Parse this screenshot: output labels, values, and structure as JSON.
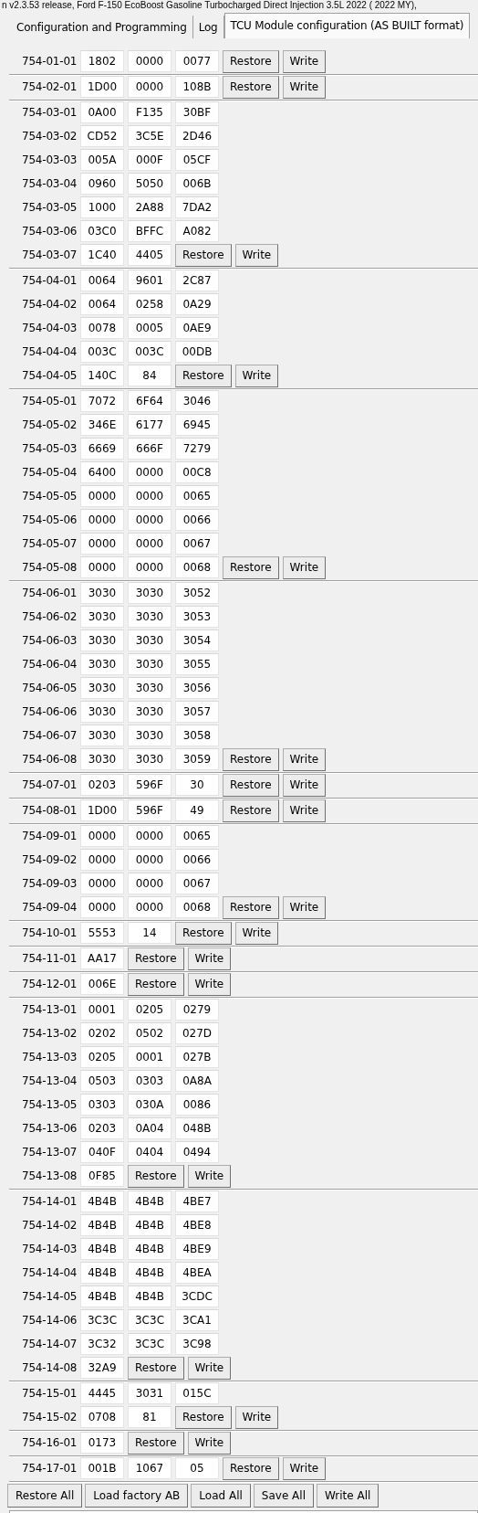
{
  "window": {
    "title": "n v2.3.53 release, Ford F-150 EcoBoost Gasoline Turbocharged Direct Injection 3.5L 2022 ( 2022 MY),"
  },
  "tabs": [
    {
      "label": "Configuration and Programming",
      "selected": false
    },
    {
      "label": "Log",
      "selected": false
    },
    {
      "label": "TCU Module configuration (AS BUILT format)",
      "selected": true
    }
  ],
  "groups": [
    {
      "rows": [
        {
          "id": "754-01-01",
          "values": [
            "1802",
            "0000",
            "0077"
          ],
          "actions": [
            "Restore",
            "Write"
          ]
        }
      ]
    },
    {
      "rows": [
        {
          "id": "754-02-01",
          "values": [
            "1D00",
            "0000",
            "108B"
          ],
          "actions": [
            "Restore",
            "Write"
          ]
        }
      ]
    },
    {
      "rows": [
        {
          "id": "754-03-01",
          "values": [
            "0A00",
            "F135",
            "30BF"
          ]
        },
        {
          "id": "754-03-02",
          "values": [
            "CD52",
            "3C5E",
            "2D46"
          ]
        },
        {
          "id": "754-03-03",
          "values": [
            "005A",
            "000F",
            "05CF"
          ]
        },
        {
          "id": "754-03-04",
          "values": [
            "0960",
            "5050",
            "006B"
          ]
        },
        {
          "id": "754-03-05",
          "values": [
            "1000",
            "2A88",
            "7DA2"
          ]
        },
        {
          "id": "754-03-06",
          "values": [
            "03C0",
            "BFFC",
            "A082"
          ]
        },
        {
          "id": "754-03-07",
          "values": [
            "1C40",
            "4405"
          ],
          "actions": [
            "Restore",
            "Write"
          ]
        }
      ]
    },
    {
      "rows": [
        {
          "id": "754-04-01",
          "values": [
            "0064",
            "9601",
            "2C87"
          ]
        },
        {
          "id": "754-04-02",
          "values": [
            "0064",
            "0258",
            "0A29"
          ]
        },
        {
          "id": "754-04-03",
          "values": [
            "0078",
            "0005",
            "0AE9"
          ]
        },
        {
          "id": "754-04-04",
          "values": [
            "003C",
            "003C",
            "00DB"
          ]
        },
        {
          "id": "754-04-05",
          "values": [
            "140C",
            "84"
          ],
          "actions": [
            "Restore",
            "Write"
          ]
        }
      ]
    },
    {
      "rows": [
        {
          "id": "754-05-01",
          "values": [
            "7072",
            "6F64",
            "3046"
          ]
        },
        {
          "id": "754-05-02",
          "values": [
            "346E",
            "6177",
            "6945"
          ]
        },
        {
          "id": "754-05-03",
          "values": [
            "6669",
            "666F",
            "7279"
          ]
        },
        {
          "id": "754-05-04",
          "values": [
            "6400",
            "0000",
            "00C8"
          ]
        },
        {
          "id": "754-05-05",
          "values": [
            "0000",
            "0000",
            "0065"
          ]
        },
        {
          "id": "754-05-06",
          "values": [
            "0000",
            "0000",
            "0066"
          ]
        },
        {
          "id": "754-05-07",
          "values": [
            "0000",
            "0000",
            "0067"
          ]
        },
        {
          "id": "754-05-08",
          "values": [
            "0000",
            "0000",
            "0068"
          ],
          "actions": [
            "Restore",
            "Write"
          ]
        }
      ]
    },
    {
      "rows": [
        {
          "id": "754-06-01",
          "values": [
            "3030",
            "3030",
            "3052"
          ]
        },
        {
          "id": "754-06-02",
          "values": [
            "3030",
            "3030",
            "3053"
          ]
        },
        {
          "id": "754-06-03",
          "values": [
            "3030",
            "3030",
            "3054"
          ]
        },
        {
          "id": "754-06-04",
          "values": [
            "3030",
            "3030",
            "3055"
          ]
        },
        {
          "id": "754-06-05",
          "values": [
            "3030",
            "3030",
            "3056"
          ]
        },
        {
          "id": "754-06-06",
          "values": [
            "3030",
            "3030",
            "3057"
          ]
        },
        {
          "id": "754-06-07",
          "values": [
            "3030",
            "3030",
            "3058"
          ]
        },
        {
          "id": "754-06-08",
          "values": [
            "3030",
            "3030",
            "3059"
          ],
          "actions": [
            "Restore",
            "Write"
          ]
        }
      ]
    },
    {
      "rows": [
        {
          "id": "754-07-01",
          "values": [
            "0203",
            "596F",
            "30"
          ],
          "actions": [
            "Restore",
            "Write"
          ]
        }
      ]
    },
    {
      "rows": [
        {
          "id": "754-08-01",
          "values": [
            "1D00",
            "596F",
            "49"
          ],
          "actions": [
            "Restore",
            "Write"
          ]
        }
      ]
    },
    {
      "rows": [
        {
          "id": "754-09-01",
          "values": [
            "0000",
            "0000",
            "0065"
          ]
        },
        {
          "id": "754-09-02",
          "values": [
            "0000",
            "0000",
            "0066"
          ]
        },
        {
          "id": "754-09-03",
          "values": [
            "0000",
            "0000",
            "0067"
          ]
        },
        {
          "id": "754-09-04",
          "values": [
            "0000",
            "0000",
            "0068"
          ],
          "actions": [
            "Restore",
            "Write"
          ]
        }
      ]
    },
    {
      "rows": [
        {
          "id": "754-10-01",
          "values": [
            "5553",
            "14"
          ],
          "actions": [
            "Restore",
            "Write"
          ]
        }
      ]
    },
    {
      "rows": [
        {
          "id": "754-11-01",
          "values": [
            "AA17"
          ],
          "actions": [
            "Restore",
            "Write"
          ]
        }
      ]
    },
    {
      "rows": [
        {
          "id": "754-12-01",
          "values": [
            "006E"
          ],
          "actions": [
            "Restore",
            "Write"
          ]
        }
      ]
    },
    {
      "rows": [
        {
          "id": "754-13-01",
          "values": [
            "0001",
            "0205",
            "0279"
          ]
        },
        {
          "id": "754-13-02",
          "values": [
            "0202",
            "0502",
            "027D"
          ]
        },
        {
          "id": "754-13-03",
          "values": [
            "0205",
            "0001",
            "027B"
          ]
        },
        {
          "id": "754-13-04",
          "values": [
            "0503",
            "0303",
            "0A8A"
          ]
        },
        {
          "id": "754-13-05",
          "values": [
            "0303",
            "030A",
            "0086"
          ]
        },
        {
          "id": "754-13-06",
          "values": [
            "0203",
            "0A04",
            "048B"
          ]
        },
        {
          "id": "754-13-07",
          "values": [
            "040F",
            "0404",
            "0494"
          ]
        },
        {
          "id": "754-13-08",
          "values": [
            "0F85"
          ],
          "actions": [
            "Restore",
            "Write"
          ]
        }
      ]
    },
    {
      "rows": [
        {
          "id": "754-14-01",
          "values": [
            "4B4B",
            "4B4B",
            "4BE7"
          ]
        },
        {
          "id": "754-14-02",
          "values": [
            "4B4B",
            "4B4B",
            "4BE8"
          ]
        },
        {
          "id": "754-14-03",
          "values": [
            "4B4B",
            "4B4B",
            "4BE9"
          ]
        },
        {
          "id": "754-14-04",
          "values": [
            "4B4B",
            "4B4B",
            "4BEA"
          ]
        },
        {
          "id": "754-14-05",
          "values": [
            "4B4B",
            "4B4B",
            "3CDC"
          ]
        },
        {
          "id": "754-14-06",
          "values": [
            "3C3C",
            "3C3C",
            "3CA1"
          ]
        },
        {
          "id": "754-14-07",
          "values": [
            "3C32",
            "3C3C",
            "3C98"
          ]
        },
        {
          "id": "754-14-08",
          "values": [
            "32A9"
          ],
          "actions": [
            "Restore",
            "Write"
          ]
        }
      ]
    },
    {
      "rows": [
        {
          "id": "754-15-01",
          "values": [
            "4445",
            "3031",
            "015C"
          ]
        },
        {
          "id": "754-15-02",
          "values": [
            "0708",
            "81"
          ],
          "actions": [
            "Restore",
            "Write"
          ]
        }
      ]
    },
    {
      "rows": [
        {
          "id": "754-16-01",
          "values": [
            "0173"
          ],
          "actions": [
            "Restore",
            "Write"
          ]
        }
      ]
    },
    {
      "rows": [
        {
          "id": "754-17-01",
          "values": [
            "001B",
            "1067",
            "05"
          ],
          "actions": [
            "Restore",
            "Write"
          ]
        }
      ]
    }
  ],
  "footer_buttons": [
    "Restore All",
    "Load factory AB",
    "Load All",
    "Save All",
    "Write All"
  ]
}
